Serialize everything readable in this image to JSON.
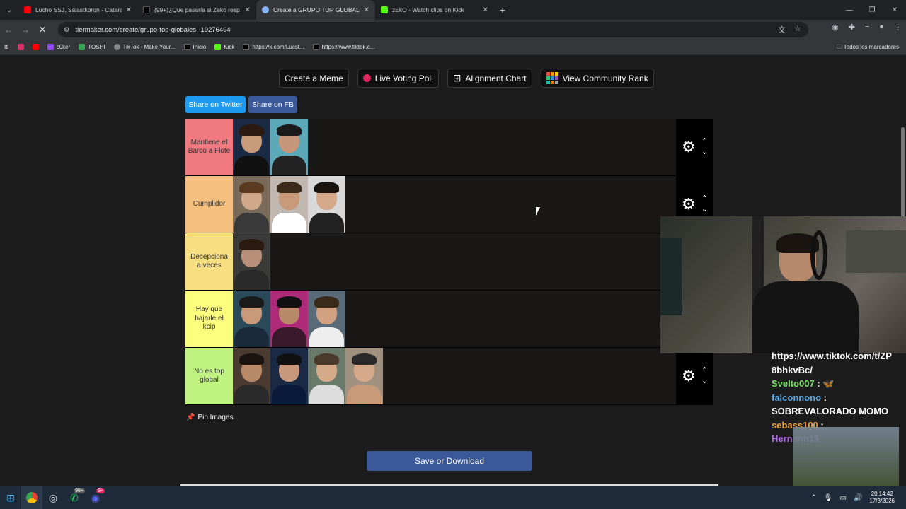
{
  "browser": {
    "tabs": [
      {
        "title": "Lucho SSJ, Salastkbron - Catara",
        "fav_color": "#ff0000"
      },
      {
        "title": "(99+)¿Que pasaría si Zeko resp",
        "fav_color": "#000000"
      },
      {
        "title": "Create a GRUPO TOP GLOBALE",
        "fav_color": "#8ab4f8"
      },
      {
        "title": "zEkO - Watch clips on Kick",
        "fav_color": "#53fc18"
      }
    ],
    "url": "tiermaker.com/create/grupo-top-globales--19276494",
    "bookmarks": [
      {
        "label": "",
        "color": "#e1306c"
      },
      {
        "label": "",
        "color": "#ff0000"
      },
      {
        "label": "c0ker",
        "color": "#9146ff"
      },
      {
        "label": "TOSHI",
        "color": "#34a853"
      },
      {
        "label": "TikTok - Make Your...",
        "color": "#888888"
      },
      {
        "label": "Inicio",
        "color": "#000000"
      },
      {
        "label": "Kick",
        "color": "#53fc18"
      },
      {
        "label": "https://x.com/Lucst...",
        "color": "#000000"
      },
      {
        "label": "https://www.tiktok.c...",
        "color": "#000000"
      }
    ],
    "all_bookmarks": "Todos los marcadores"
  },
  "page": {
    "buttons": {
      "meme": "Create a Meme",
      "poll": "Live Voting Poll",
      "alignment": "Alignment Chart",
      "community": "View Community Rank"
    },
    "share_twitter": "Share on Twitter",
    "share_fb": "Share on FB",
    "pin_images": "Pin Images",
    "save": "Save or Download",
    "tiers": [
      {
        "label": "Mantiene el Barco a Flote",
        "color": "#f07a80",
        "count": 2
      },
      {
        "label": "Cumplidor",
        "color": "#f5bf80",
        "count": 3
      },
      {
        "label": "Decepciona a veces",
        "color": "#f7de80",
        "count": 1
      },
      {
        "label": "Hay que bajarle el kcip",
        "color": "#fdfe7e",
        "count": 3
      },
      {
        "label": "No es top global",
        "color": "#bff280",
        "count": 4
      }
    ]
  },
  "chat": [
    {
      "user": "",
      "text": "https://www.tiktok.com/t/ZP"
    },
    {
      "user": "",
      "text": "8bhkvBc/"
    },
    {
      "user": "Svelto007",
      "text": " : 🦋"
    },
    {
      "user": "falconnono",
      "text": " :"
    },
    {
      "user": "",
      "text": "SOBREVALORADO MOMO"
    },
    {
      "user": "sebass100",
      "text": " :"
    },
    {
      "user": "Hernann19",
      "text": ""
    }
  ],
  "taskbar": {
    "time": "20:14:42",
    "date": "17/3/2026",
    "badge1": "99+",
    "badge2": "9+"
  }
}
